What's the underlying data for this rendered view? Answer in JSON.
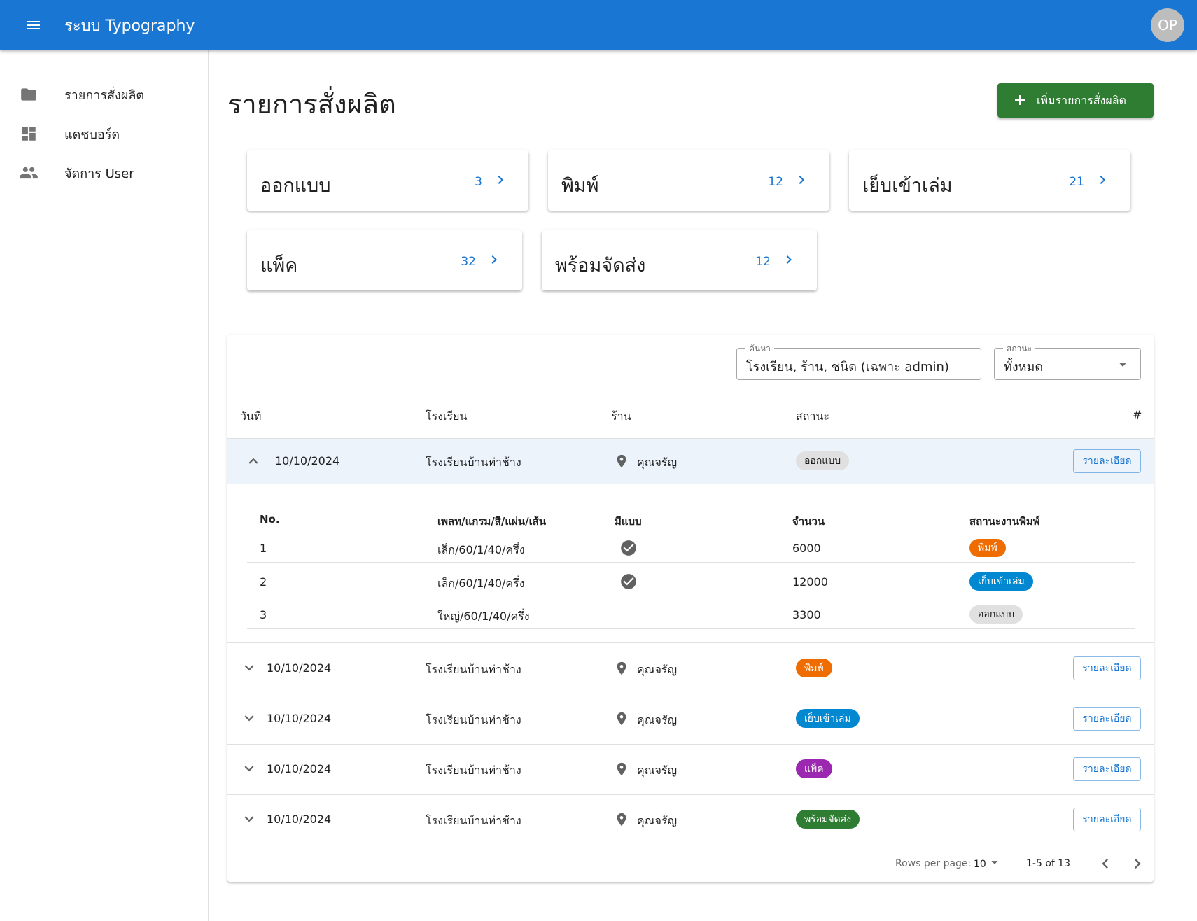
{
  "app": {
    "title": "ระบบ Typography",
    "avatar_initials": "OP",
    "primary_color": "#1976d2"
  },
  "sidebar": {
    "items": [
      {
        "label": "รายการสั่งผลิต",
        "icon": "folder-icon"
      },
      {
        "label": "แดชบอร์ด",
        "icon": "dashboard-icon"
      },
      {
        "label": "จัดการ User",
        "icon": "people-icon"
      }
    ]
  },
  "main": {
    "title": "รายการสั่งผลิต",
    "add_button_label": "เพิ่มรายการสั่งผลิต",
    "stat_cards": [
      {
        "label": "ออกแบบ",
        "count": "3"
      },
      {
        "label": "พิมพ์",
        "count": "12"
      },
      {
        "label": "เย็บเข้าเล่ม",
        "count": "21"
      },
      {
        "label": "แพ็ค",
        "count": "32"
      },
      {
        "label": "พร้อมจัดส่ง",
        "count": "12"
      }
    ]
  },
  "filters": {
    "search_label": "ค้นหา",
    "search_value": "โรงเรียน, ร้าน, ชนิด (เฉพาะ admin)",
    "status_label": "สถานะ",
    "status_value": "ทั้งหมด"
  },
  "table": {
    "headers": [
      "วันที่",
      "โรงเรียน",
      "ร้าน",
      "สถานะ",
      "#"
    ],
    "detail_button_label": "รายละเอียด",
    "rows": [
      {
        "date": "10/10/2024",
        "school": "โรงเรียนบ้านท่าช้าง",
        "shop": "คุณจรัญ",
        "status": "ออกแบบ",
        "status_color": "#e0e0e0",
        "expanded": true
      },
      {
        "date": "10/10/2024",
        "school": "โรงเรียนบ้านท่าช้าง",
        "shop": "คุณจรัญ",
        "status": "พิมพ์",
        "status_color": "#ef6c00",
        "expanded": false
      },
      {
        "date": "10/10/2024",
        "school": "โรงเรียนบ้านท่าช้าง",
        "shop": "คุณจรัญ",
        "status": "เย็บเข้าเล่ม",
        "status_color": "#0288d1",
        "expanded": false
      },
      {
        "date": "10/10/2024",
        "school": "โรงเรียนบ้านท่าช้าง",
        "shop": "คุณจรัญ",
        "status": "แพ็ค",
        "status_color": "#9c27b0",
        "expanded": false
      },
      {
        "date": "10/10/2024",
        "school": "โรงเรียนบ้านท่าช้าง",
        "shop": "คุณจรัญ",
        "status": "พร้อมจัดส่ง",
        "status_color": "#2e7d32",
        "expanded": false
      }
    ],
    "sub_headers": [
      "No.",
      "เพลท/แกรม/สี/แผ่น/เส้น",
      "มีแบบ",
      "จำนวน",
      "สถานะงานพิมพ์"
    ],
    "sub_rows": [
      {
        "no": "1",
        "spec": "เล็ก/60/1/40/ครึ่ง",
        "has_design": true,
        "qty": "6000",
        "status": "พิมพ์",
        "status_color": "#ef6c00"
      },
      {
        "no": "2",
        "spec": "เล็ก/60/1/40/ครึ่ง",
        "has_design": true,
        "qty": "12000",
        "status": "เย็บเข้าเล่ม",
        "status_color": "#0288d1"
      },
      {
        "no": "3",
        "spec": "ใหญ่/60/1/40/ครึ่ง",
        "has_design": false,
        "qty": "3300",
        "status": "ออกแบบ",
        "status_color": "#e0e0e0"
      }
    ]
  },
  "pagination": {
    "rows_per_page_label": "Rows per page:",
    "rows_per_page_value": "10",
    "range_text": "1-5 of 13"
  }
}
